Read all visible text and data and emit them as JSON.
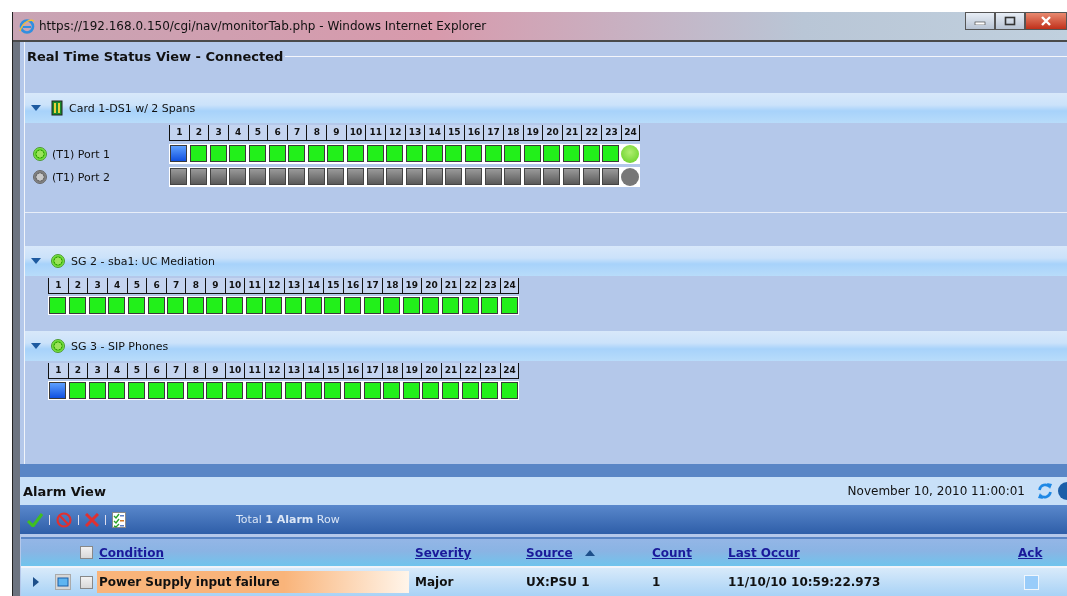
{
  "window": {
    "title": "https://192.168.0.150/cgi/nav/monitorTab.php - Windows Internet Explorer"
  },
  "status_view": {
    "title": "Real Time Status View - Connected",
    "groups": [
      {
        "kind": "card",
        "title": "Card 1-DS1 w/ 2 Spans",
        "expanded": true,
        "channel_numbers": [
          "1",
          "2",
          "3",
          "4",
          "5",
          "6",
          "7",
          "8",
          "9",
          "10",
          "11",
          "12",
          "13",
          "14",
          "15",
          "16",
          "17",
          "18",
          "19",
          "20",
          "21",
          "22",
          "23",
          "24"
        ],
        "ports": [
          {
            "label": "(T1) Port 1",
            "active": true,
            "channels": [
              {
                "kind": "square",
                "active": true,
                "busy": true
              },
              {
                "kind": "square",
                "active": true,
                "busy": false
              },
              {
                "kind": "square",
                "active": true,
                "busy": false
              },
              {
                "kind": "square",
                "active": true,
                "busy": false
              },
              {
                "kind": "square",
                "active": true,
                "busy": false
              },
              {
                "kind": "square",
                "active": true,
                "busy": false
              },
              {
                "kind": "square",
                "active": true,
                "busy": false
              },
              {
                "kind": "square",
                "active": true,
                "busy": false
              },
              {
                "kind": "square",
                "active": true,
                "busy": false
              },
              {
                "kind": "square",
                "active": true,
                "busy": false
              },
              {
                "kind": "square",
                "active": true,
                "busy": false
              },
              {
                "kind": "square",
                "active": true,
                "busy": false
              },
              {
                "kind": "square",
                "active": true,
                "busy": false
              },
              {
                "kind": "square",
                "active": true,
                "busy": false
              },
              {
                "kind": "square",
                "active": true,
                "busy": false
              },
              {
                "kind": "square",
                "active": true,
                "busy": false
              },
              {
                "kind": "square",
                "active": true,
                "busy": false
              },
              {
                "kind": "square",
                "active": true,
                "busy": false
              },
              {
                "kind": "square",
                "active": true,
                "busy": false
              },
              {
                "kind": "square",
                "active": true,
                "busy": false
              },
              {
                "kind": "square",
                "active": true,
                "busy": false
              },
              {
                "kind": "square",
                "active": true,
                "busy": false
              },
              {
                "kind": "square",
                "active": true,
                "busy": false
              },
              {
                "kind": "round",
                "active": true,
                "busy": false
              }
            ]
          },
          {
            "label": "(T1) Port 2",
            "active": false,
            "channels": [
              {
                "kind": "square",
                "active": false,
                "busy": false
              },
              {
                "kind": "square",
                "active": false,
                "busy": false
              },
              {
                "kind": "square",
                "active": false,
                "busy": false
              },
              {
                "kind": "square",
                "active": false,
                "busy": false
              },
              {
                "kind": "square",
                "active": false,
                "busy": false
              },
              {
                "kind": "square",
                "active": false,
                "busy": false
              },
              {
                "kind": "square",
                "active": false,
                "busy": false
              },
              {
                "kind": "square",
                "active": false,
                "busy": false
              },
              {
                "kind": "square",
                "active": false,
                "busy": false
              },
              {
                "kind": "square",
                "active": false,
                "busy": false
              },
              {
                "kind": "square",
                "active": false,
                "busy": false
              },
              {
                "kind": "square",
                "active": false,
                "busy": false
              },
              {
                "kind": "square",
                "active": false,
                "busy": false
              },
              {
                "kind": "square",
                "active": false,
                "busy": false
              },
              {
                "kind": "square",
                "active": false,
                "busy": false
              },
              {
                "kind": "square",
                "active": false,
                "busy": false
              },
              {
                "kind": "square",
                "active": false,
                "busy": false
              },
              {
                "kind": "square",
                "active": false,
                "busy": false
              },
              {
                "kind": "square",
                "active": false,
                "busy": false
              },
              {
                "kind": "square",
                "active": false,
                "busy": false
              },
              {
                "kind": "square",
                "active": false,
                "busy": false
              },
              {
                "kind": "square",
                "active": false,
                "busy": false
              },
              {
                "kind": "square",
                "active": false,
                "busy": false
              },
              {
                "kind": "round",
                "active": false,
                "busy": false
              }
            ]
          }
        ]
      },
      {
        "kind": "group",
        "title": "SG 2 - sba1: UC Mediation",
        "active": true,
        "expanded": true,
        "channel_numbers": [
          "1",
          "2",
          "3",
          "4",
          "5",
          "6",
          "7",
          "8",
          "9",
          "10",
          "11",
          "12",
          "13",
          "14",
          "15",
          "16",
          "17",
          "18",
          "19",
          "20",
          "21",
          "22",
          "23",
          "24"
        ],
        "ports": [
          {
            "channels": [
              {
                "kind": "square",
                "active": true,
                "busy": false
              },
              {
                "kind": "square",
                "active": true,
                "busy": false
              },
              {
                "kind": "square",
                "active": true,
                "busy": false
              },
              {
                "kind": "square",
                "active": true,
                "busy": false
              },
              {
                "kind": "square",
                "active": true,
                "busy": false
              },
              {
                "kind": "square",
                "active": true,
                "busy": false
              },
              {
                "kind": "square",
                "active": true,
                "busy": false
              },
              {
                "kind": "square",
                "active": true,
                "busy": false
              },
              {
                "kind": "square",
                "active": true,
                "busy": false
              },
              {
                "kind": "square",
                "active": true,
                "busy": false
              },
              {
                "kind": "square",
                "active": true,
                "busy": false
              },
              {
                "kind": "square",
                "active": true,
                "busy": false
              },
              {
                "kind": "square",
                "active": true,
                "busy": false
              },
              {
                "kind": "square",
                "active": true,
                "busy": false
              },
              {
                "kind": "square",
                "active": true,
                "busy": false
              },
              {
                "kind": "square",
                "active": true,
                "busy": false
              },
              {
                "kind": "square",
                "active": true,
                "busy": false
              },
              {
                "kind": "square",
                "active": true,
                "busy": false
              },
              {
                "kind": "square",
                "active": true,
                "busy": false
              },
              {
                "kind": "square",
                "active": true,
                "busy": false
              },
              {
                "kind": "square",
                "active": true,
                "busy": false
              },
              {
                "kind": "square",
                "active": true,
                "busy": false
              },
              {
                "kind": "square",
                "active": true,
                "busy": false
              },
              {
                "kind": "square",
                "active": true,
                "busy": false
              }
            ]
          }
        ]
      },
      {
        "kind": "group",
        "title": "SG 3 - SIP Phones",
        "active": true,
        "expanded": true,
        "channel_numbers": [
          "1",
          "2",
          "3",
          "4",
          "5",
          "6",
          "7",
          "8",
          "9",
          "10",
          "11",
          "12",
          "13",
          "14",
          "15",
          "16",
          "17",
          "18",
          "19",
          "20",
          "21",
          "22",
          "23",
          "24"
        ],
        "ports": [
          {
            "channels": [
              {
                "kind": "square",
                "active": true,
                "busy": true
              },
              {
                "kind": "square",
                "active": true,
                "busy": false
              },
              {
                "kind": "square",
                "active": true,
                "busy": false
              },
              {
                "kind": "square",
                "active": true,
                "busy": false
              },
              {
                "kind": "square",
                "active": true,
                "busy": false
              },
              {
                "kind": "square",
                "active": true,
                "busy": false
              },
              {
                "kind": "square",
                "active": true,
                "busy": false
              },
              {
                "kind": "square",
                "active": true,
                "busy": false
              },
              {
                "kind": "square",
                "active": true,
                "busy": false
              },
              {
                "kind": "square",
                "active": true,
                "busy": false
              },
              {
                "kind": "square",
                "active": true,
                "busy": false
              },
              {
                "kind": "square",
                "active": true,
                "busy": false
              },
              {
                "kind": "square",
                "active": true,
                "busy": false
              },
              {
                "kind": "square",
                "active": true,
                "busy": false
              },
              {
                "kind": "square",
                "active": true,
                "busy": false
              },
              {
                "kind": "square",
                "active": true,
                "busy": false
              },
              {
                "kind": "square",
                "active": true,
                "busy": false
              },
              {
                "kind": "square",
                "active": true,
                "busy": false
              },
              {
                "kind": "square",
                "active": true,
                "busy": false
              },
              {
                "kind": "square",
                "active": true,
                "busy": false
              },
              {
                "kind": "square",
                "active": true,
                "busy": false
              },
              {
                "kind": "square",
                "active": true,
                "busy": false
              },
              {
                "kind": "square",
                "active": true,
                "busy": false
              },
              {
                "kind": "square",
                "active": true,
                "busy": false
              }
            ]
          }
        ]
      }
    ]
  },
  "alarm_view": {
    "title": "Alarm View",
    "timestamp": "November 10, 2010 11:00:01",
    "total": "Total **1 Alarm** Row",
    "header_checked": false,
    "columns": [
      {
        "label": "Condition",
        "sorted": false
      },
      {
        "label": "Severity",
        "sorted": false
      },
      {
        "label": "Source",
        "sorted": true
      },
      {
        "label": "Count",
        "sorted": false
      },
      {
        "label": "Last Occur",
        "sorted": false
      },
      {
        "label": "Ack",
        "sorted": false
      }
    ],
    "rows": [
      {
        "expanded": false,
        "checked": false,
        "condition": "Power Supply input failure",
        "color": "#f9b47a",
        "severity": "Major",
        "source": "UX:PSU 1",
        "count": "1",
        "last_occur": "11/10/10 10:59:22.973",
        "acknowledged": false
      }
    ]
  }
}
